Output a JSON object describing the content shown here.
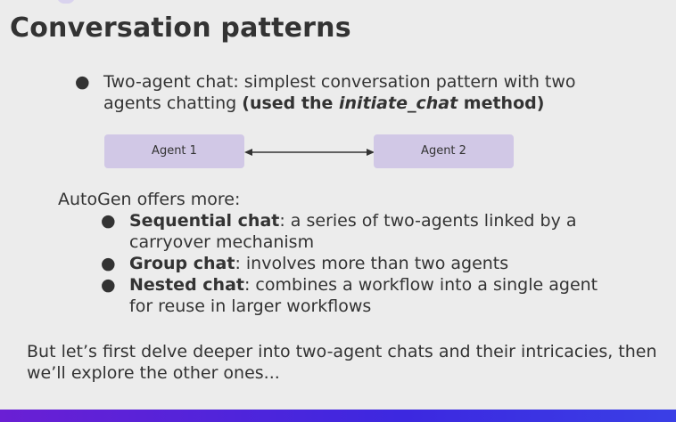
{
  "slide": {
    "title": "Conversation patterns",
    "main_bullet": {
      "bullet": "●",
      "text": "Two-agent chat: simplest conversation pattern with two agents chatting ",
      "bold_open": "(used the ",
      "bold_italic": "initiate_chat",
      "bold_close": " method)"
    },
    "diagram": {
      "agent1": "Agent 1",
      "agent2": "Agent 2"
    },
    "more_intro": "AutoGen offers more:",
    "sub_items": [
      {
        "bullet": "●",
        "name": "Sequential chat",
        "desc": ": a series of two-agents linked by a carryover mechanism"
      },
      {
        "bullet": "●",
        "name": "Group chat",
        "desc": ": involves more than two agents"
      },
      {
        "bullet": "●",
        "name": "Nested chat",
        "desc": ": combines a workflow into a single agent for reuse in larger workflows"
      }
    ],
    "closing": "But let’s first delve deeper into two-agent chats and their intricacies, then we’ll explore the other ones..."
  },
  "colors": {
    "background": "#ececec",
    "text": "#333333",
    "agent_box": "#d1c8e6",
    "bottom_bar_start": "#6a1fd4",
    "bottom_bar_end": "#3a3fe6"
  }
}
